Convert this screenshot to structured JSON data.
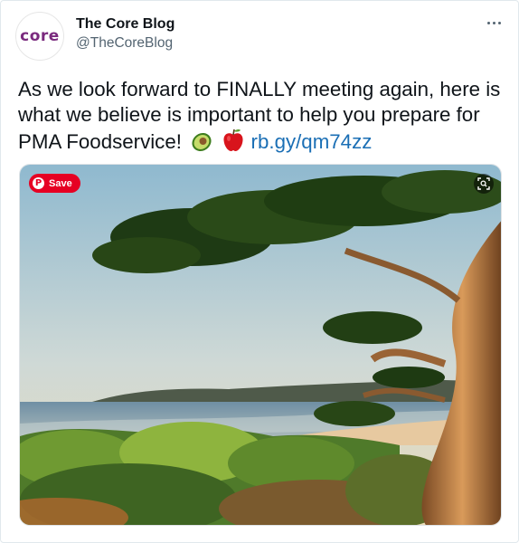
{
  "author": {
    "avatar_text": "core",
    "name": "The Core Blog",
    "handle": "@TheCoreBlog"
  },
  "tweet": {
    "text": "As we look forward to FINALLY meeting again, here is what we believe is important to help you prepare for PMA Foodservice!",
    "emojis": [
      "avocado-icon",
      "red-apple-icon"
    ],
    "link_text": "rb.gy/qm74zz"
  },
  "media": {
    "save_label": "Save",
    "icons": [
      "pinterest-icon",
      "visual-search-icon"
    ]
  },
  "menu": {
    "icon": "more-options-icon"
  }
}
